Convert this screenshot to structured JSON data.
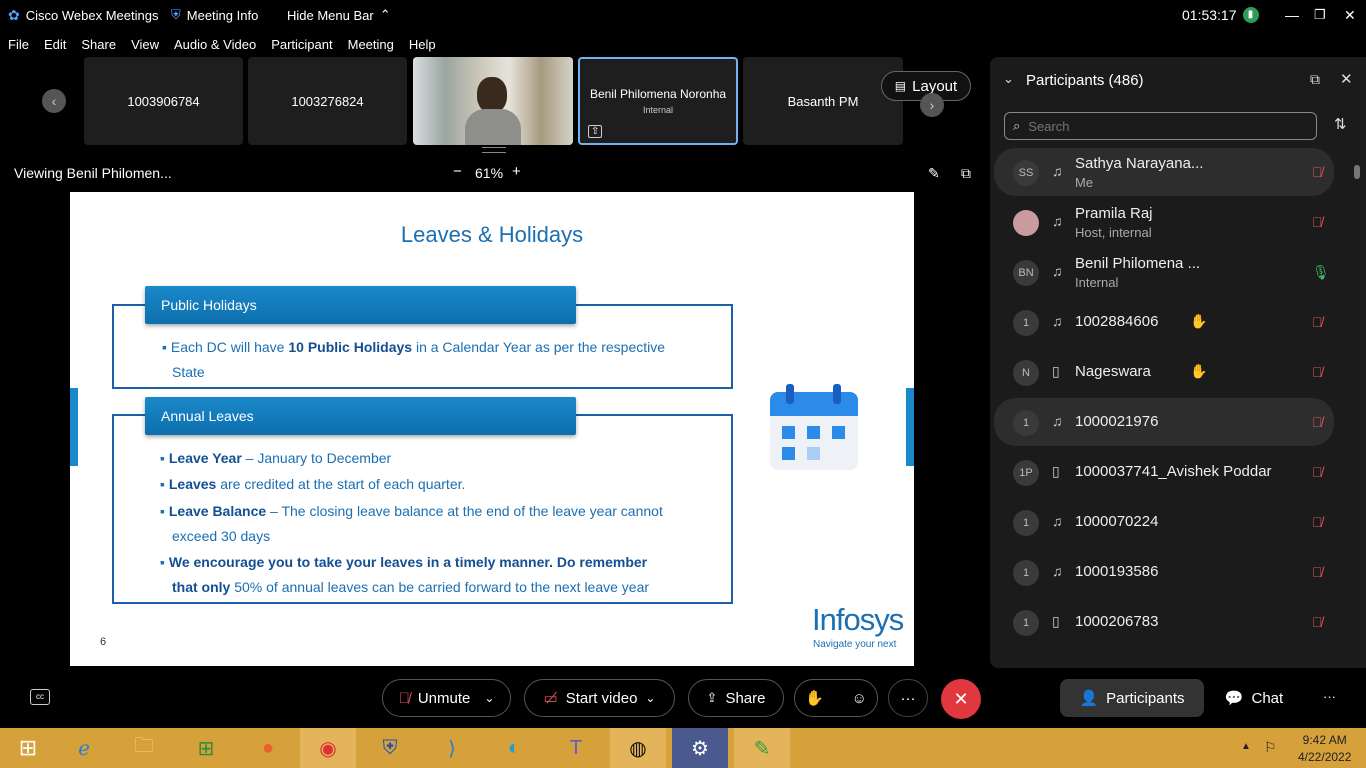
{
  "titlebar": {
    "app": "Cisco Webex Meetings",
    "meeting_info": "Meeting Info",
    "hide_menu": "Hide Menu Bar",
    "clock": "01:53:17"
  },
  "menu": [
    "File",
    "Edit",
    "Share",
    "View",
    "Audio & Video",
    "Participant",
    "Meeting",
    "Help"
  ],
  "strip": {
    "tiles": [
      {
        "name": "1003906784",
        "sub": ""
      },
      {
        "name": "1003276824",
        "sub": ""
      },
      {
        "name": "",
        "sub": ""
      },
      {
        "name": "Benil Philomena Noronha",
        "sub": "Internal"
      },
      {
        "name": "Basanth PM",
        "sub": ""
      }
    ],
    "layout_label": "Layout"
  },
  "viewing": {
    "label": "Viewing Benil Philomen...",
    "zoom_minus": "−",
    "zoom": "61%",
    "zoom_plus": "+"
  },
  "slide": {
    "title": "Leaves & Holidays",
    "section1": "Public Holidays",
    "s1_bullet_a": "Each DC will have",
    "s1_bullet_bold": "10 Public Holidays",
    "s1_bullet_b": "in a Calendar Year as per the respective",
    "s1_bullet_c": "State",
    "section2": "Annual Leaves",
    "b1_bold": "Leave Year",
    "b1_rest": "– January to December",
    "b2_bold": "Leaves",
    "b2_rest": "are credited at the start of each quarter.",
    "b3_bold": "Leave Balance",
    "b3_rest": "– The closing leave balance at the end of the leave year cannot",
    "b3_cont": "exceed 30 days",
    "b4_bold": "We encourage you to take your leaves in a timely manner. Do remember",
    "b4_bold2": "that only",
    "b4_rest": "50% of annual leaves can be carried forward to the next leave year",
    "page_no": "6",
    "logo": "Infosys",
    "tagline": "Navigate your next"
  },
  "panel": {
    "title": "Participants (486)",
    "search_placeholder": "Search",
    "participants": [
      {
        "initials": "SS",
        "name": "Sathya Narayana...",
        "sub": "Me",
        "hand": false,
        "mic": "muted",
        "device": "audio"
      },
      {
        "initials": "",
        "name": "Pramila Raj",
        "sub": "Host, internal",
        "hand": false,
        "mic": "muted",
        "device": "audio"
      },
      {
        "initials": "BN",
        "name": "Benil Philomena ...",
        "sub": "Internal",
        "hand": false,
        "mic": "on",
        "device": "audio"
      },
      {
        "initials": "1",
        "name": "1002884606",
        "sub": "",
        "hand": true,
        "mic": "muted",
        "device": "audio"
      },
      {
        "initials": "N",
        "name": "Nageswara",
        "sub": "",
        "hand": true,
        "mic": "muted",
        "device": "phone"
      },
      {
        "initials": "1",
        "name": "1000021976",
        "sub": "",
        "hand": false,
        "mic": "muted",
        "device": "audio"
      },
      {
        "initials": "1P",
        "name": "1000037741_Avishek Poddar",
        "sub": "",
        "hand": false,
        "mic": "muted",
        "device": "phone"
      },
      {
        "initials": "1",
        "name": "1000070224",
        "sub": "",
        "hand": false,
        "mic": "muted",
        "device": "audio"
      },
      {
        "initials": "1",
        "name": "1000193586",
        "sub": "",
        "hand": false,
        "mic": "muted",
        "device": "audio"
      },
      {
        "initials": "1",
        "name": "1000206783",
        "sub": "",
        "hand": false,
        "mic": "muted",
        "device": "phone"
      }
    ]
  },
  "controls": {
    "unmute": "Unmute",
    "start_video": "Start video",
    "share": "Share",
    "more": "···",
    "participants": "Participants",
    "chat": "Chat",
    "overflow": "···"
  },
  "taskbar": {
    "time": "9:42 AM",
    "date": "4/22/2022"
  },
  "colors": {
    "accent": "#6fb3f3",
    "end_call": "#e0383e",
    "taskbar": "#d6a03a",
    "slide_blue": "#1b5fa8"
  }
}
